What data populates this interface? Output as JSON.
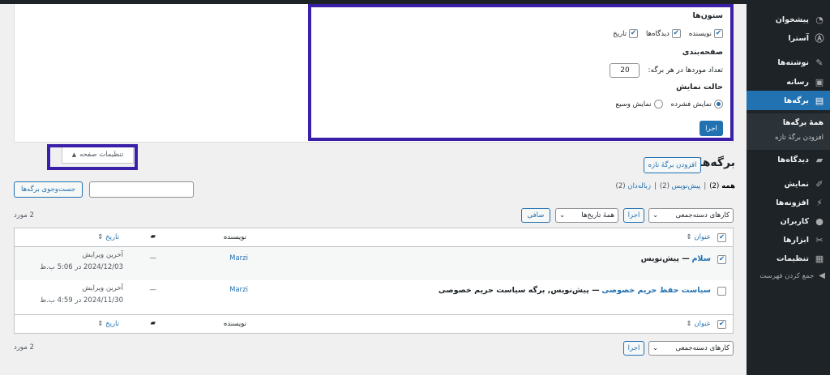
{
  "sidebar": {
    "items": [
      {
        "label": "پیشخوان",
        "icon": "dashboard-icon"
      },
      {
        "label": "آسترا",
        "icon": "astra-icon"
      },
      {
        "label": "نوشته‌ها",
        "icon": "pin-icon"
      },
      {
        "label": "رسانه",
        "icon": "media-icon"
      },
      {
        "label": "برگه‌ها",
        "icon": "pages-icon"
      },
      {
        "label": "دیدگاه‌ها",
        "icon": "comments-icon"
      },
      {
        "label": "نمایش",
        "icon": "appearance-icon"
      },
      {
        "label": "افزونه‌ها",
        "icon": "plugins-icon"
      },
      {
        "label": "کاربران",
        "icon": "users-icon"
      },
      {
        "label": "ابزارها",
        "icon": "tools-icon"
      },
      {
        "label": "تنظیمات",
        "icon": "settings-icon"
      }
    ],
    "submenu": [
      "همهٔ برگه‌ها",
      "افزودن برگهٔ تازه"
    ],
    "collapse_label": "جمع کردن فهرست"
  },
  "screen_options": {
    "columns_title": "ستون‌ها",
    "columns": [
      {
        "label": "نویسنده",
        "checked": true
      },
      {
        "label": "دیدگاه‌ها",
        "checked": true
      },
      {
        "label": "تاریخ",
        "checked": true
      }
    ],
    "pagination_title": "صفحه‌بندی",
    "per_page_label": "تعداد موردها در هر برگه:",
    "per_page_value": "20",
    "view_mode_title": "حالت نمایش",
    "view_modes": [
      {
        "label": "نمایش فشرده",
        "selected": true
      },
      {
        "label": "نمایش وسیع",
        "selected": false
      }
    ],
    "apply_label": "اجرا",
    "tab_label": "تنظیمات صفحه"
  },
  "page": {
    "title": "برگه‌ها",
    "add_new_label": "افزودن برگهٔ تازه",
    "filters": {
      "all": "همه",
      "all_count": "(2)",
      "drafts": "پیش‌نویس",
      "drafts_count": "(2)",
      "trash": "زباله‌دان",
      "trash_count": "(2)",
      "sep": "|"
    },
    "search_button": "جست‌وجوی برگه‌ها",
    "bulk_actions": "کارهای دسته‌جمعی",
    "apply": "اجرا",
    "all_dates": "همهٔ تاریخ‌ها",
    "filter_button": "صافی",
    "item_count": "2 مورد"
  },
  "table": {
    "headers": {
      "title": "عنوان",
      "author": "نویسنده",
      "date": "تاریخ"
    },
    "rows": [
      {
        "title": "سلام",
        "state": "— پیش‌نویس",
        "author": "Marzi",
        "comments": "—",
        "date_label": "آخرین ویرایش",
        "date_value": "2024/12/03 در 5:06 ب.ظ"
      },
      {
        "title": "سیاست حفظ حریم خصوصی",
        "state": "— پیش‌نویس, برگه سیاست حریم خصوصی",
        "author": "Marzi",
        "comments": "—",
        "date_label": "آخرین ویرایش",
        "date_value": "2024/11/30 در 4:59 ب.ظ"
      }
    ]
  },
  "colors": {
    "accent": "#2271b1",
    "highlight": "#3b1fa8",
    "sidebar": "#1d2327"
  }
}
